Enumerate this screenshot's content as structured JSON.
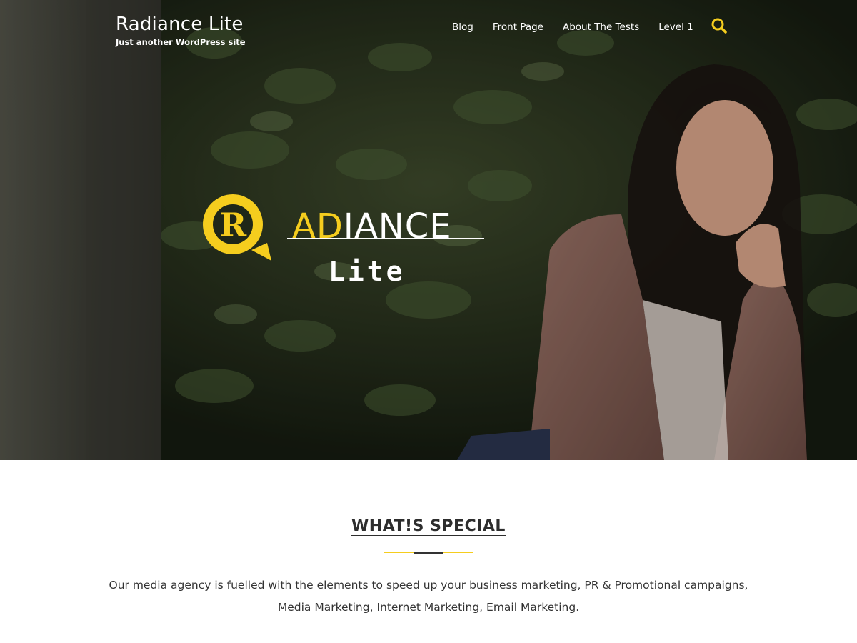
{
  "header": {
    "site_title": "Radiance Lite",
    "site_description": "Just another WordPress site"
  },
  "nav": {
    "items": [
      {
        "label": "Blog"
      },
      {
        "label": "Front Page"
      },
      {
        "label": "About The Tests"
      },
      {
        "label": "Level 1"
      }
    ],
    "search_icon": "search-icon"
  },
  "hero": {
    "logo_text": "ADIANCE",
    "logo_text_accent": "AD",
    "logo_text_rest": "IANCE",
    "logo_letter": "R",
    "logo_sub": "Lite"
  },
  "special": {
    "title": "WHAT!S SPECIAL",
    "text": "Our media agency is fuelled with the elements to speed up your business marketing, PR & Promotional campaigns, Media Marketing, Internet Marketing, Email Marketing."
  },
  "colors": {
    "accent": "#f5cd1e",
    "text_dark": "#2d2d2d",
    "white": "#ffffff"
  }
}
